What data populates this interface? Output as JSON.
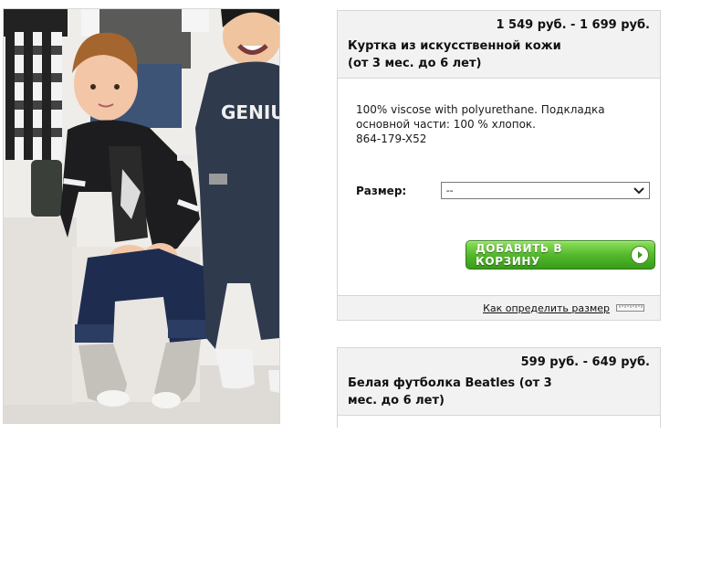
{
  "product1": {
    "price": "1 549 руб. - 1 699 руб.",
    "title": "Куртка из искусственной кожи (от 3 мес. до 6 лет)",
    "description_line1": "100% viscose with polyurethane. Подкладка основной части: 100 % хлопок.",
    "sku": "864-179-X52",
    "size_label": "Размер:",
    "size_selected": "--",
    "add_to_cart": "ДОБАВИТЬ В КОРЗИНУ",
    "size_help_link": "Как определить размер"
  },
  "product2": {
    "price": "599 руб. - 649 руб.",
    "title": "Белая футболка Beatles (от 3 мес. до 6 лет)"
  },
  "photo": {
    "shirt_text": "GENIU"
  },
  "colors": {
    "button_green": "#54b92d",
    "header_bg": "#f2f2f2",
    "border": "#d6d6d6"
  }
}
